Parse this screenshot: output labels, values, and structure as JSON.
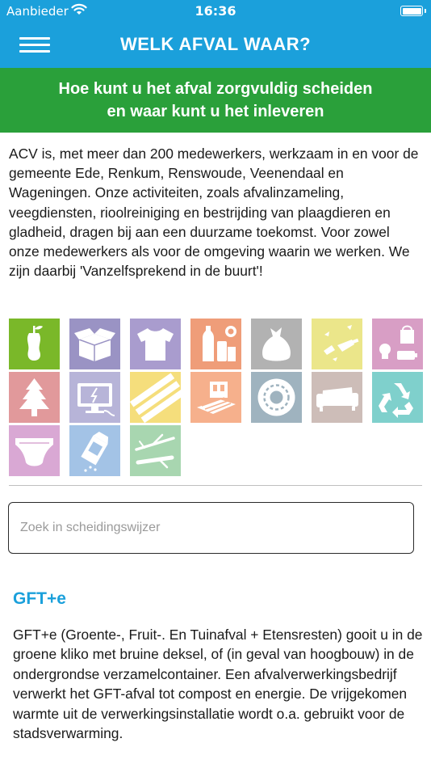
{
  "status_bar": {
    "carrier": "Aanbieder",
    "time": "16:36"
  },
  "nav": {
    "title": "WELK AFVAL WAAR?"
  },
  "banner": {
    "line1": "Hoe kunt u het afval zorgvuldig scheiden",
    "line2": "en waar kunt u het inleveren"
  },
  "intro": {
    "text": "ACV is, met meer dan 200 medewerkers, werkzaam in en voor de gemeente Ede, Renkum, Renswoude, Veenendaal en Wageningen. Onze activiteiten, zoals afvalinzameling, veegdiensten, rioolreiniging en bestrijding van plaagdieren en gladheid, dragen bij aan een duurzame toekomst. Voor zowel onze medewerkers als voor de omgeving waarin we werken. We zijn daarbij 'Vanzelfsprekend in de buurt'!"
  },
  "categories": [
    {
      "icon": "apple-core-icon",
      "color": "#7ab829"
    },
    {
      "icon": "cardboard-box-icon",
      "color": "#9a93c4"
    },
    {
      "icon": "tshirt-icon",
      "color": "#a99cce"
    },
    {
      "icon": "bottles-cans-icon",
      "color": "#ef9d79"
    },
    {
      "icon": "trash-bag-icon",
      "color": "#b2b2b2"
    },
    {
      "icon": "broken-glass-icon",
      "color": "#ebe68a"
    },
    {
      "icon": "chemical-waste-icon",
      "color": "#d89ec5"
    },
    {
      "icon": "tree-icon",
      "color": "#e1999b"
    },
    {
      "icon": "electronics-icon",
      "color": "#b7b4d8"
    },
    {
      "icon": "wood-planks-icon",
      "color": "#f5de7c"
    },
    {
      "icon": "building-rubble-icon",
      "color": "#f6b08c"
    },
    {
      "icon": "tire-icon",
      "color": "#9fb3bf"
    },
    {
      "icon": "sofa-icon",
      "color": "#cdbdb8"
    },
    {
      "icon": "recycle-icon",
      "color": "#7fd0cc"
    },
    {
      "icon": "diaper-icon",
      "color": "#d9a8d4"
    },
    {
      "icon": "milk-carton-icon",
      "color": "#a3c3e6"
    },
    {
      "icon": "branches-icon",
      "color": "#a8d6b0"
    }
  ],
  "search": {
    "placeholder": "Zoek in scheidingswijzer",
    "value": ""
  },
  "section": {
    "title": "GFT+e",
    "body": "GFT+e (Groente-, Fruit-. En Tuinafval + Etensresten) gooit u in de groene kliko met bruine deksel, of (in geval van hoogbouw) in de ondergrondse verzamelcontainer. Een afvalverwerkingsbedrijf verwerkt het GFT-afval tot compost en energie. De vrijgekomen warmte uit de verwerkingsinstallatie wordt o.a. gebruikt voor de stadsverwarming."
  }
}
